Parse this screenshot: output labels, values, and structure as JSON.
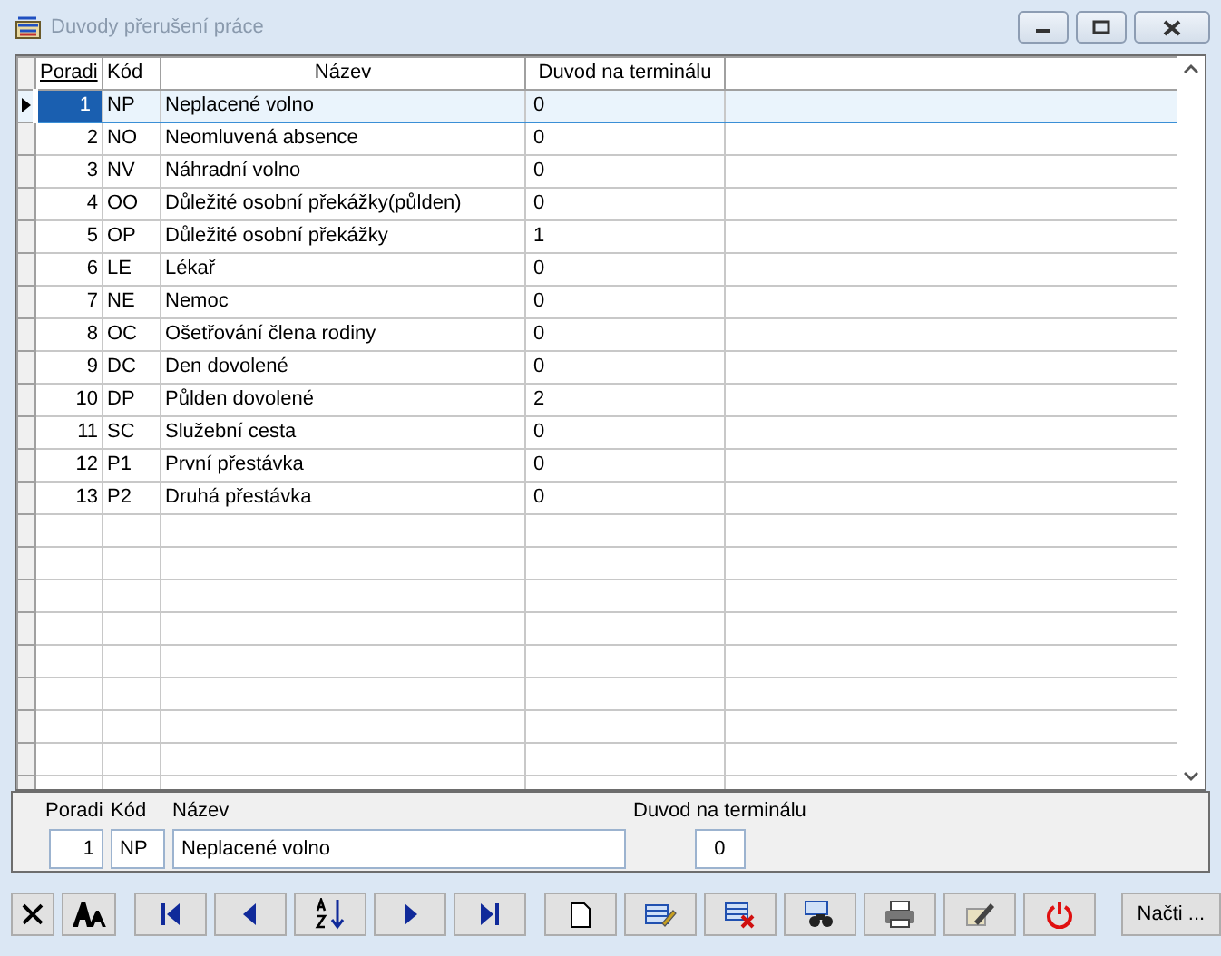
{
  "window": {
    "title": "Duvody přerušení práce"
  },
  "table": {
    "columns": [
      {
        "label": "Poradi",
        "sorted": true
      },
      {
        "label": "Kód",
        "sorted": false
      },
      {
        "label": "Název",
        "sorted": false
      },
      {
        "label": "Duvod na terminálu",
        "sorted": false
      }
    ],
    "rows": [
      {
        "cells": [
          "1",
          "NP",
          "Neplacené volno",
          "0"
        ],
        "selected": true
      },
      {
        "cells": [
          "2",
          "NO",
          "Neomluvená absence",
          "0"
        ],
        "selected": false
      },
      {
        "cells": [
          "3",
          "NV",
          "Náhradní volno",
          "0"
        ],
        "selected": false
      },
      {
        "cells": [
          "4",
          "OO",
          "Důležité osobní překážky(půlden)",
          "0"
        ],
        "selected": false
      },
      {
        "cells": [
          "5",
          "OP",
          "Důležité osobní překážky",
          "1"
        ],
        "selected": false
      },
      {
        "cells": [
          "6",
          "LE",
          "Lékař",
          "0"
        ],
        "selected": false
      },
      {
        "cells": [
          "7",
          "NE",
          "Nemoc",
          "0"
        ],
        "selected": false
      },
      {
        "cells": [
          "8",
          "OC",
          "Ošetřování člena rodiny",
          "0"
        ],
        "selected": false
      },
      {
        "cells": [
          "9",
          "DC",
          "Den dovolené",
          "0"
        ],
        "selected": false
      },
      {
        "cells": [
          "10",
          "DP",
          "Půlden dovolené",
          "2"
        ],
        "selected": false
      },
      {
        "cells": [
          "11",
          "SC",
          "Služební cesta",
          "0"
        ],
        "selected": false
      },
      {
        "cells": [
          "12",
          "P1",
          "První přestávka",
          "0"
        ],
        "selected": false
      },
      {
        "cells": [
          "13",
          "P2",
          "Druhá přestávka",
          "0"
        ],
        "selected": false
      }
    ]
  },
  "detail": {
    "fields": [
      {
        "label": "Poradi",
        "value": "1"
      },
      {
        "label": "Kód",
        "value": "NP"
      },
      {
        "label": "Název",
        "value": "Neplacené volno"
      },
      {
        "label": "Duvod na terminálu",
        "value": "0"
      }
    ]
  },
  "toolbar": [
    {
      "kind": "cancel"
    },
    {
      "kind": "font"
    },
    {
      "kind": "first"
    },
    {
      "kind": "prev"
    },
    {
      "kind": "sort"
    },
    {
      "kind": "next"
    },
    {
      "kind": "last"
    },
    {
      "kind": "new"
    },
    {
      "kind": "edit"
    },
    {
      "kind": "delete"
    },
    {
      "kind": "find"
    },
    {
      "kind": "print"
    },
    {
      "kind": "settings"
    },
    {
      "kind": "power"
    },
    {
      "kind": "text",
      "label": "Načti ..."
    }
  ]
}
